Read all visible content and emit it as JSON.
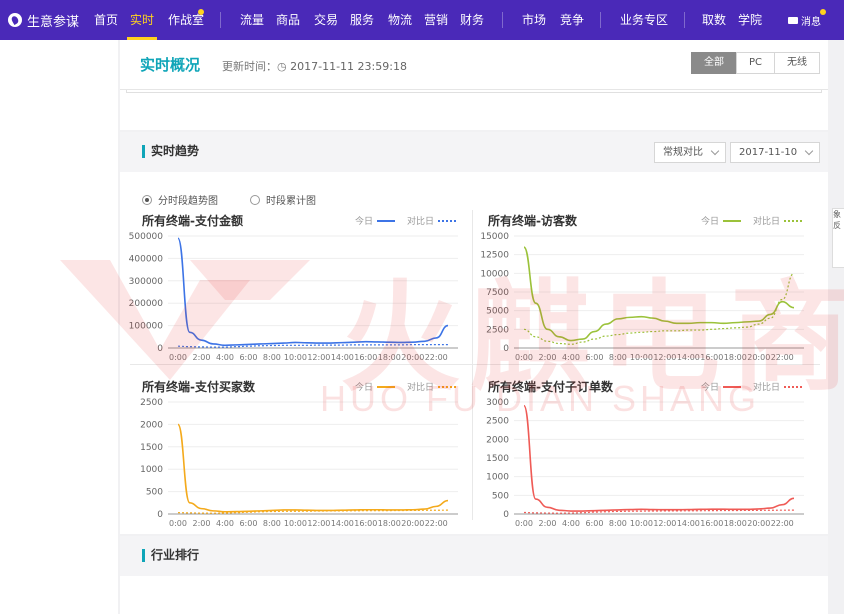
{
  "nav": {
    "brand": "生意参谋",
    "items": [
      "首页",
      "实时",
      "作战室",
      "流量",
      "商品",
      "交易",
      "服务",
      "物流",
      "营销",
      "财务",
      "市场",
      "竞争",
      "业务专区",
      "取数",
      "学院"
    ],
    "active": "实时",
    "message": "消息"
  },
  "header": {
    "title": "实时概况",
    "update_label": "更新时间：",
    "update_time": "2017-11-11 23:59:18",
    "terminal_buttons": [
      "全部",
      "PC",
      "无线"
    ],
    "terminal_selected": "全部"
  },
  "trend": {
    "title": "实时趋势",
    "compare_select": "常规对比",
    "date_select": "2017-11-10",
    "radio_options": [
      "分时段趋势图",
      "时段累计图"
    ],
    "radio_selected": "分时段趋势图",
    "legend_today": "今日",
    "legend_compare": "对比日"
  },
  "ranking": {
    "title": "行业排行"
  },
  "watermark": {
    "cn": "火麒电商",
    "en": "HUO FU DIAN SHANG"
  },
  "right_stub": "象反",
  "colors": {
    "nav_bg": "#4a29b8",
    "accent": "#0fa5b8",
    "active": "#ffd21e",
    "blue": "#3d74e6",
    "green": "#9bc23a",
    "orange": "#f4aa1c",
    "red": "#ef5b56"
  },
  "chart_data": [
    {
      "type": "line",
      "title": "所有终端-支付金额",
      "x": [
        "0:00",
        "2:00",
        "4:00",
        "6:00",
        "8:00",
        "10:00",
        "12:00",
        "14:00",
        "16:00",
        "18:00",
        "20:00",
        "22:00"
      ],
      "ylim": [
        0,
        500000
      ],
      "yticks": [
        0,
        100000,
        200000,
        300000,
        400000,
        500000
      ],
      "series": [
        {
          "name": "今日",
          "color": "#3d74e6",
          "values": [
            490000,
            70000,
            35000,
            18000,
            12000,
            14000,
            16000,
            18000,
            20000,
            22000,
            25000,
            23000,
            22000,
            22000,
            24000,
            26000,
            28000,
            27000,
            26000,
            25000,
            26000,
            30000,
            45000,
            100000
          ]
        },
        {
          "name": "对比日",
          "color": "#3d74e6",
          "dashed": true,
          "values": [
            8000,
            6000,
            5000,
            4000,
            4000,
            6000,
            8000,
            10000,
            11000,
            12000,
            12000,
            12000,
            13000,
            13000,
            13000,
            14000,
            14000,
            14000,
            14000,
            14000,
            15000,
            15000,
            15000,
            15000
          ]
        }
      ]
    },
    {
      "type": "line",
      "title": "所有终端-访客数",
      "x": [
        "0:00",
        "2:00",
        "4:00",
        "6:00",
        "8:00",
        "10:00",
        "12:00",
        "14:00",
        "16:00",
        "18:00",
        "20:00",
        "22:00"
      ],
      "ylim": [
        0,
        15000
      ],
      "yticks": [
        0,
        2500,
        5000,
        7500,
        10000,
        12500,
        15000
      ],
      "series": [
        {
          "name": "今日",
          "color": "#9bc23a",
          "values": [
            13500,
            6000,
            2500,
            1500,
            1000,
            1200,
            2200,
            3200,
            3900,
            4100,
            4200,
            4000,
            3600,
            3300,
            3300,
            3400,
            3400,
            3300,
            3400,
            3500,
            3600,
            4500,
            6200,
            5400
          ]
        },
        {
          "name": "对比日",
          "color": "#9bc23a",
          "dashed": true,
          "values": [
            2500,
            1500,
            900,
            600,
            500,
            800,
            1200,
            1600,
            1800,
            2000,
            2100,
            2200,
            2300,
            2300,
            2400,
            2400,
            2500,
            2600,
            2700,
            2800,
            3200,
            4000,
            6500,
            10000
          ]
        }
      ]
    },
    {
      "type": "line",
      "title": "所有终端-支付买家数",
      "x": [
        "0:00",
        "2:00",
        "4:00",
        "6:00",
        "8:00",
        "10:00",
        "12:00",
        "14:00",
        "16:00",
        "18:00",
        "20:00",
        "22:00"
      ],
      "ylim": [
        0,
        2500
      ],
      "yticks": [
        0,
        500,
        1000,
        1500,
        2000,
        2500
      ],
      "series": [
        {
          "name": "今日",
          "color": "#f4aa1c",
          "values": [
            2000,
            250,
            120,
            70,
            50,
            55,
            60,
            70,
            80,
            90,
            90,
            85,
            80,
            80,
            85,
            90,
            95,
            95,
            90,
            90,
            95,
            110,
            170,
            300
          ]
        },
        {
          "name": "对比日",
          "color": "#f4aa1c",
          "dashed": true,
          "values": [
            30,
            25,
            20,
            18,
            20,
            30,
            40,
            50,
            55,
            60,
            62,
            64,
            66,
            68,
            70,
            72,
            74,
            75,
            76,
            78,
            80,
            82,
            84,
            86
          ]
        }
      ]
    },
    {
      "type": "line",
      "title": "所有终端-支付子订单数",
      "x": [
        "0:00",
        "2:00",
        "4:00",
        "6:00",
        "8:00",
        "10:00",
        "12:00",
        "14:00",
        "16:00",
        "18:00",
        "20:00",
        "22:00"
      ],
      "ylim": [
        0,
        3000
      ],
      "yticks": [
        0,
        500,
        1000,
        1500,
        2000,
        2500,
        3000
      ],
      "series": [
        {
          "name": "今日",
          "color": "#ef5b56",
          "values": [
            2900,
            400,
            180,
            100,
            80,
            80,
            90,
            100,
            110,
            120,
            125,
            120,
            115,
            115,
            120,
            125,
            130,
            130,
            125,
            125,
            135,
            160,
            250,
            420
          ]
        },
        {
          "name": "对比日",
          "color": "#ef5b56",
          "dashed": true,
          "values": [
            40,
            30,
            25,
            22,
            25,
            35,
            50,
            60,
            70,
            75,
            78,
            80,
            82,
            84,
            86,
            88,
            90,
            92,
            94,
            96,
            98,
            100,
            102,
            104
          ]
        }
      ]
    }
  ]
}
